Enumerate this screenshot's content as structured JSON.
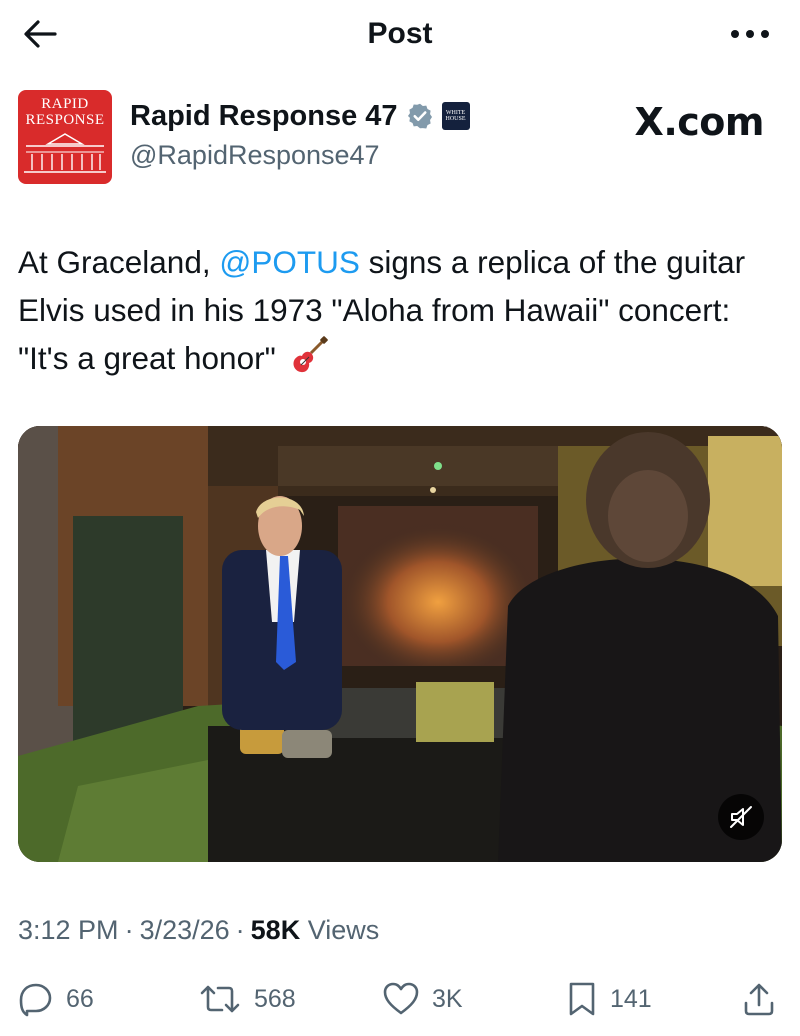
{
  "header": {
    "title": "Post"
  },
  "author": {
    "avatar_line1": "RAPID",
    "avatar_line2": "RESPONSE",
    "name": "Rapid Response 47",
    "affiliation_badge_line1": "WHITE",
    "affiliation_badge_line2": "HOUSE",
    "handle": "@RapidResponse47",
    "source_label": "X.com"
  },
  "tweet": {
    "text_part1": "At Graceland, ",
    "mention": "@POTUS",
    "text_part2": " signs a replica of the guitar Elvis used in his 1973 \"Aloha from Hawaii\" concert: \"It's a great honor\" "
  },
  "meta": {
    "time": "3:12 PM",
    "date": "3/23/26",
    "views_count": "58K",
    "views_label": "Views",
    "separator": "·"
  },
  "actions": {
    "replies": "66",
    "reposts": "568",
    "likes": "3K",
    "bookmarks": "141"
  },
  "colors": {
    "accent": "#1d9bf0",
    "secondary_text": "#536471",
    "avatar_red": "#d92b2b"
  }
}
